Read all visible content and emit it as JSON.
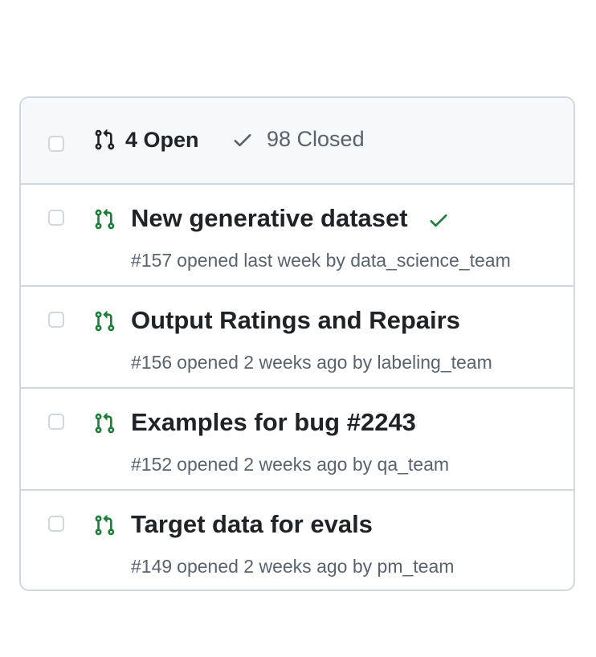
{
  "header": {
    "open_tab": {
      "label": "4 Open",
      "icon": "git-pull-request-icon"
    },
    "closed_tab": {
      "label": "98 Closed",
      "icon": "check-icon"
    }
  },
  "pull_requests": [
    {
      "title": "New generative dataset",
      "number": "#157",
      "opened": "opened last week by",
      "author": "data_science_team",
      "status": "success-check"
    },
    {
      "title": "Output Ratings and Repairs",
      "number": "#156",
      "opened": "opened 2 weeks ago by",
      "author": "labeling_team",
      "status": ""
    },
    {
      "title": "Examples for bug #2243",
      "number": "#152",
      "opened": "opened 2 weeks ago by",
      "author": "qa_team",
      "status": ""
    },
    {
      "title": "Target data for evals",
      "number": "#149",
      "opened": "opened 2 weeks ago by",
      "author": "pm_team",
      "status": ""
    }
  ],
  "colors": {
    "open_green": "#1a7f37",
    "border": "#d0d7de",
    "header_bg": "#f6f8fa",
    "muted_text": "#59636e"
  }
}
